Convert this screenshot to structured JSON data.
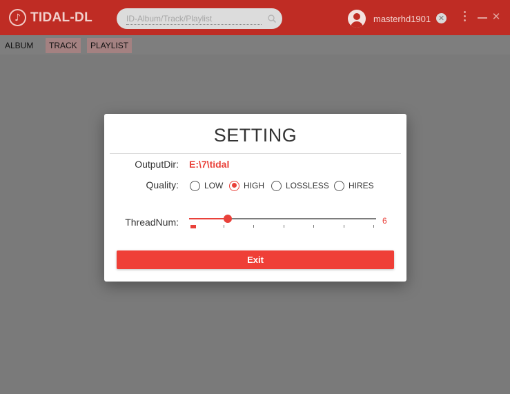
{
  "app": {
    "title": "TIDAL-DL",
    "logo_icon": "music-note-icon",
    "accent_color": "#bf2c24"
  },
  "search": {
    "placeholder": "ID-Album/Track/Playlist",
    "value": ""
  },
  "user": {
    "name": "masterhd1901"
  },
  "window_controls": {
    "close_glyph": "✕",
    "logout_glyph": "✕"
  },
  "tabs": [
    {
      "label": "ALBUM"
    },
    {
      "label": "TRACK"
    },
    {
      "label": "PLAYLIST"
    }
  ],
  "dialog": {
    "title": "SETTING",
    "output_dir_label": "OutputDir:",
    "output_dir_value": "E:\\7\\tidal",
    "quality_label": "Quality:",
    "quality_options": [
      {
        "label": "LOW",
        "selected": false
      },
      {
        "label": "HIGH",
        "selected": true
      },
      {
        "label": "LOSSLESS",
        "selected": false
      },
      {
        "label": "HIRES",
        "selected": false
      }
    ],
    "thread_label": "ThreadNum:",
    "thread_min": 1,
    "thread_max": 25,
    "thread_value": 6,
    "thread_value_text": "6",
    "exit_label": "Exit",
    "button_color": "#ef3f37"
  }
}
